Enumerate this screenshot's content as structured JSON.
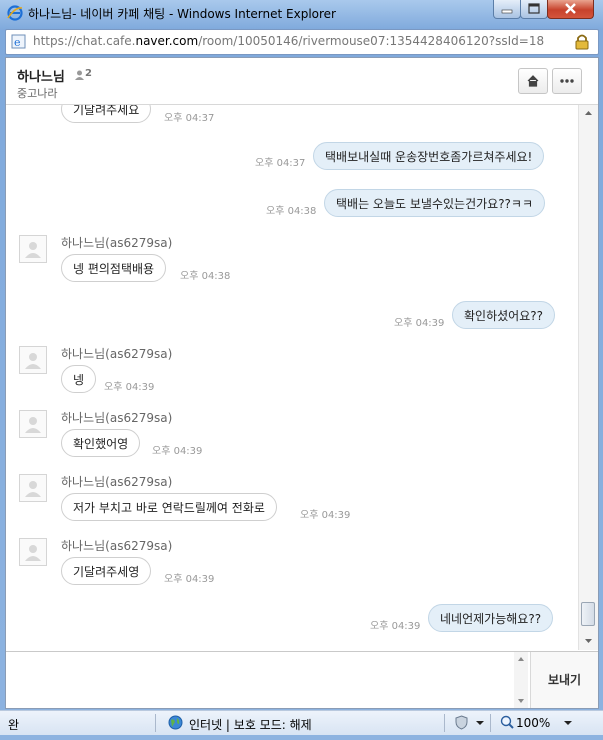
{
  "window": {
    "title": "하나느님- 네이버 카페 채팅 - Windows Internet Explorer",
    "url_prefix": "https://chat.cafe.",
    "url_domain": "naver.com",
    "url_suffix": "/room/10050146/rivermouse07:1354428406120?ssId=18"
  },
  "chat_header": {
    "room_title": "하나느님",
    "member_count": "2",
    "cafe_name": "중고나라"
  },
  "messages": [
    {
      "side": "them",
      "text": "기달려주세요",
      "time": "오후 04:37"
    },
    {
      "side": "me",
      "text": "택배보내실때 운송장번호좀가르쳐주세요!",
      "time": "오후 04:37"
    },
    {
      "side": "me",
      "text": "택배는 오늘도 보낼수있는건가요??ㅋㅋ",
      "time": "오후 04:38"
    },
    {
      "side": "them",
      "sender": "하나느님(as6279sa)",
      "text": "넹 편의점택배용",
      "time": "오후 04:38"
    },
    {
      "side": "me",
      "text": "확인하셨어요??",
      "time": "오후 04:39"
    },
    {
      "side": "them",
      "sender": "하나느님(as6279sa)",
      "text": "넹",
      "time": "오후 04:39"
    },
    {
      "side": "them",
      "sender": "하나느님(as6279sa)",
      "text": "확인했어영",
      "time": "오후 04:39"
    },
    {
      "side": "them",
      "sender": "하나느님(as6279sa)",
      "text": "저가 부치고 바로 연락드릴께여 전화로",
      "time": "오후 04:39"
    },
    {
      "side": "them",
      "sender": "하나느님(as6279sa)",
      "text": "기달려주세영",
      "time": "오후 04:39"
    },
    {
      "side": "me",
      "text": "네네언제가능해요??",
      "time": "오후 04:39"
    }
  ],
  "composer": {
    "send_label": "보내기",
    "input_value": ""
  },
  "statusbar": {
    "status": "완",
    "zone": "인터넷 | 보호 모드: 해제",
    "zoom": "100%"
  },
  "icons": [
    "ie-logo-icon",
    "minimize-icon",
    "maximize-icon",
    "close-icon",
    "page-icon",
    "lock-icon",
    "person-icon",
    "home-icon",
    "more-icon",
    "default-avatar-icon",
    "globe-icon",
    "security-shield-icon",
    "zoom-icon"
  ]
}
